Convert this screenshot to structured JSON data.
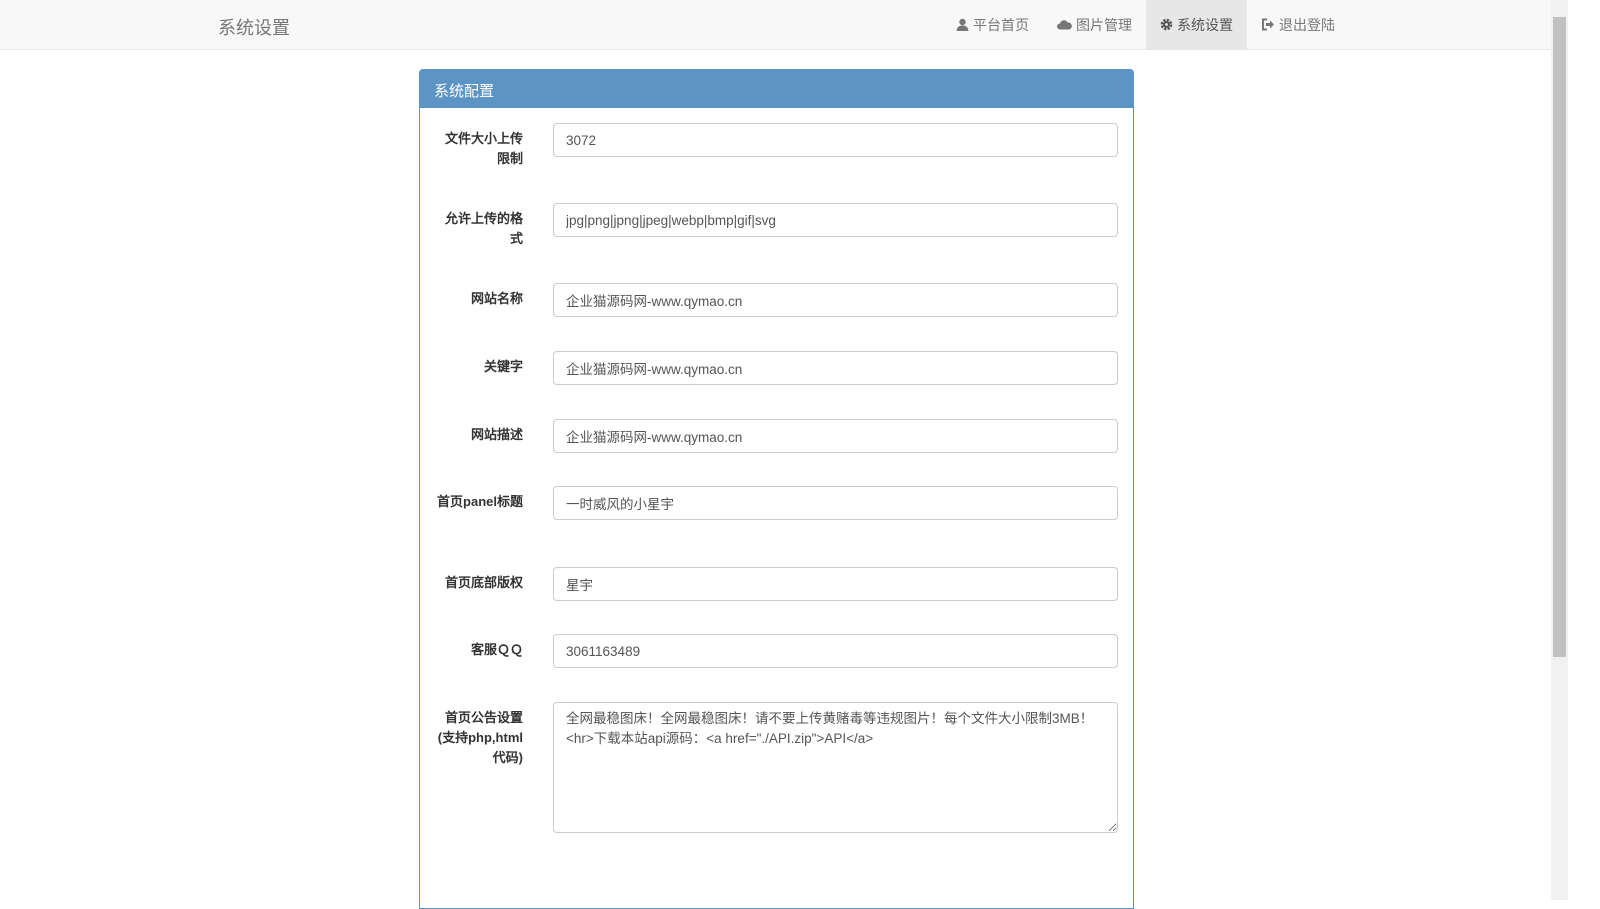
{
  "navbar": {
    "brand": "系统设置",
    "items": [
      {
        "label": "平台首页",
        "icon": "user-icon"
      },
      {
        "label": "图片管理",
        "icon": "cloud-icon"
      },
      {
        "label": "系统设置",
        "icon": "gear-icon",
        "active": true
      },
      {
        "label": "退出登陆",
        "icon": "logout-icon"
      }
    ]
  },
  "panel": {
    "title": "系统配置",
    "fields": [
      {
        "label": "文件大小上传限制",
        "value": "3072"
      },
      {
        "label": "允许上传的格式",
        "value": "jpg|png|jpng|jpeg|webp|bmp|gif|svg"
      },
      {
        "label": "网站名称",
        "value": "企业猫源码网-www.qymao.cn"
      },
      {
        "label": "关键字",
        "value": "企业猫源码网-www.qymao.cn"
      },
      {
        "label": "网站描述",
        "value": "企业猫源码网-www.qymao.cn"
      },
      {
        "label": "首页panel标题",
        "value": "一时威风的小星宇"
      },
      {
        "label": "首页底部版权",
        "value": "星宇"
      },
      {
        "label": "客服ＱＱ",
        "value": "3061163489"
      },
      {
        "label": "首页公告设置(支持php,html代码)",
        "value": "全网最稳图床！全网最稳图床！请不要上传黄赌毒等违规图片！每个文件大小限制3MB！<hr>下载本站api源码：<a href=\"./API.zip\">API</a>"
      }
    ]
  }
}
